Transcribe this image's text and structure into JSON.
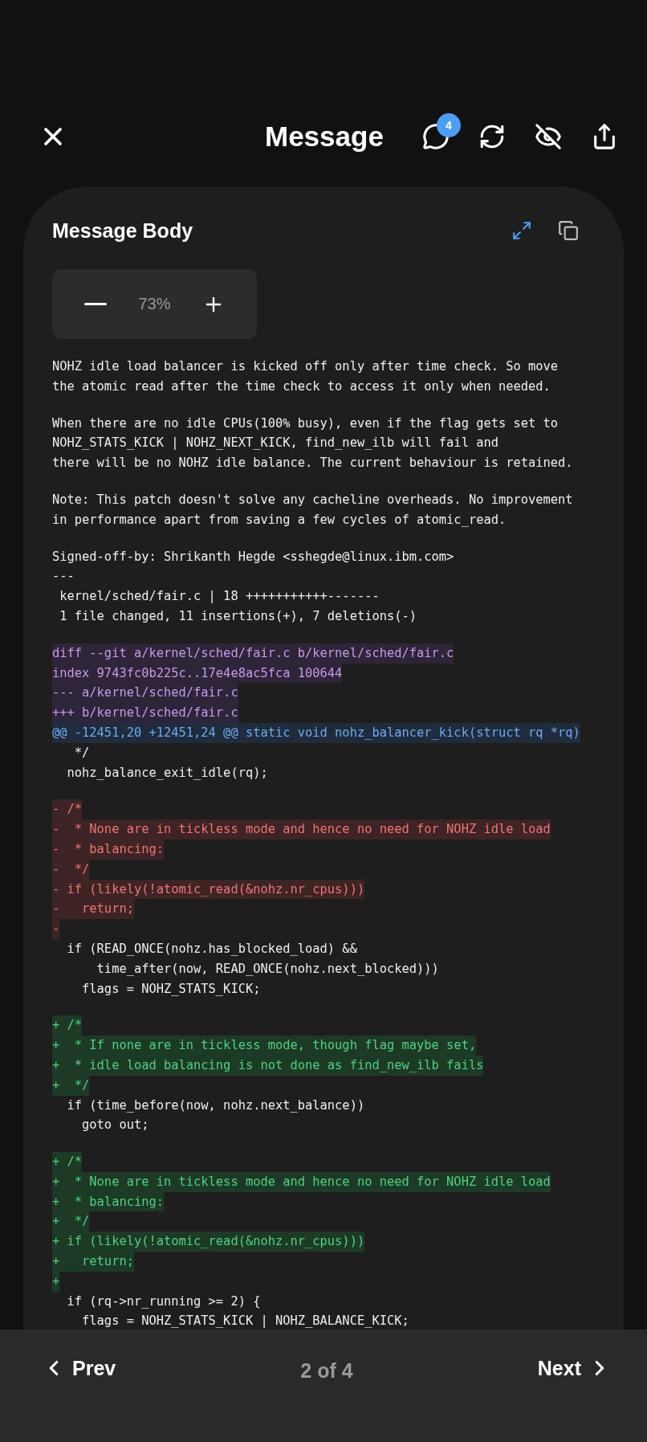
{
  "header": {
    "title": "Message",
    "badge": "4"
  },
  "card": {
    "title": "Message Body",
    "zoom": "73%"
  },
  "lines": [
    {
      "kind": "text",
      "text": "NOHZ idle load balancer is kicked off only after time check. So move\nthe atomic read after the time check to access it only when needed."
    },
    {
      "kind": "blank"
    },
    {
      "kind": "text",
      "text": "When there are no idle CPUs(100% busy), even if the flag gets set to\nNOHZ_STATS_KICK | NOHZ_NEXT_KICK, find_new_ilb will fail and\nthere will be no NOHZ idle balance. The current behaviour is retained."
    },
    {
      "kind": "blank"
    },
    {
      "kind": "text",
      "text": "Note: This patch doesn't solve any cacheline overheads. No improvement\nin performance apart from saving a few cycles of atomic_read."
    },
    {
      "kind": "blank"
    },
    {
      "kind": "text",
      "text": "Signed-off-by: Shrikanth Hegde <sshegde@linux.ibm.com>\n---\n kernel/sched/fair.c | 18 +++++++++++-------\n 1 file changed, 11 insertions(+), 7 deletions(-)"
    },
    {
      "kind": "blank"
    },
    {
      "kind": "meta",
      "text": "diff --git a/kernel/sched/fair.c b/kernel/sched/fair.c"
    },
    {
      "kind": "meta",
      "text": "index 9743fc0b225c..17e4e8ac5fca 100644"
    },
    {
      "kind": "meta",
      "text": "--- a/kernel/sched/fair.c"
    },
    {
      "kind": "meta",
      "text": "+++ b/kernel/sched/fair.c"
    },
    {
      "kind": "hunk",
      "text": "@@ -12451,20 +12451,24 @@ static void nohz_balancer_kick(struct rq *rq)"
    },
    {
      "kind": "context",
      "text": "   */"
    },
    {
      "kind": "context",
      "text": "  nohz_balance_exit_idle(rq);"
    },
    {
      "kind": "blank"
    },
    {
      "kind": "del",
      "text": "- /*"
    },
    {
      "kind": "del",
      "text": "-  * None are in tickless mode and hence no need for NOHZ idle load"
    },
    {
      "kind": "del",
      "text": "-  * balancing:"
    },
    {
      "kind": "del",
      "text": "-  */"
    },
    {
      "kind": "del",
      "text": "- if (likely(!atomic_read(&nohz.nr_cpus)))"
    },
    {
      "kind": "del",
      "text": "-   return;"
    },
    {
      "kind": "del",
      "text": "-"
    },
    {
      "kind": "context",
      "text": "  if (READ_ONCE(nohz.has_blocked_load) &&\n      time_after(now, READ_ONCE(nohz.next_blocked)))\n    flags = NOHZ_STATS_KICK;"
    },
    {
      "kind": "blank"
    },
    {
      "kind": "add",
      "text": "+ /*"
    },
    {
      "kind": "add",
      "text": "+  * If none are in tickless mode, though flag maybe set,"
    },
    {
      "kind": "add",
      "text": "+  * idle load balancing is not done as find_new_ilb fails"
    },
    {
      "kind": "add",
      "text": "+  */"
    },
    {
      "kind": "context",
      "text": "  if (time_before(now, nohz.next_balance))\n    goto out;"
    },
    {
      "kind": "blank"
    },
    {
      "kind": "add",
      "text": "+ /*"
    },
    {
      "kind": "add",
      "text": "+  * None are in tickless mode and hence no need for NOHZ idle load"
    },
    {
      "kind": "add",
      "text": "+  * balancing:"
    },
    {
      "kind": "add",
      "text": "+  */"
    },
    {
      "kind": "add",
      "text": "+ if (likely(!atomic_read(&nohz.nr_cpus)))"
    },
    {
      "kind": "add",
      "text": "+   return;"
    },
    {
      "kind": "add",
      "text": "+"
    },
    {
      "kind": "context",
      "text": "  if (rq->nr_running >= 2) {\n    flags = NOHZ_STATS_KICK | NOHZ_BALANCE_KICK;"
    }
  ],
  "pager": {
    "prev": "Prev",
    "position": "2 of 4",
    "next": "Next"
  }
}
